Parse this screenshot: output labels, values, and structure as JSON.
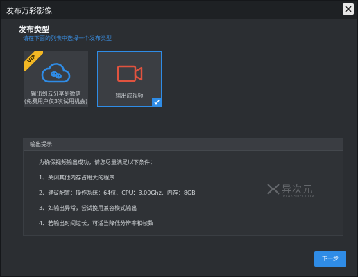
{
  "window": {
    "title": "发布万彩影像"
  },
  "publish_type": {
    "title": "发布类型",
    "hint": "请在下面的列表中选择一个发布类型",
    "options": [
      {
        "label_line1": "输出到云分享到微信",
        "label_line2": "(免费用户仅3次试用机会)",
        "badge": "VIP",
        "selected": false
      },
      {
        "label_line1": "输出成视频",
        "selected": true
      }
    ]
  },
  "info": {
    "header": "输出提示",
    "intro": "为确保视频输出成功，请您尽量满足以下条件：",
    "items": [
      "1、关闭其他内存占用大的程序",
      "2、建议配置：操作系统：64位、CPU：3.00Ghz、内存：8GB",
      "3、如输出异常，尝试换用兼容模式输出",
      "4、若输出时间过长，可适当降低分辨率和帧数"
    ]
  },
  "watermark": {
    "text": "异次元",
    "sub": "IPLAY-SOFT.COM"
  },
  "footer": {
    "next_label": "下一步"
  },
  "colors": {
    "accent": "#2f8ce6",
    "vip": "#f2b724",
    "cloud_icon": "#2f8ce6",
    "video_icon": "#e0533f"
  }
}
